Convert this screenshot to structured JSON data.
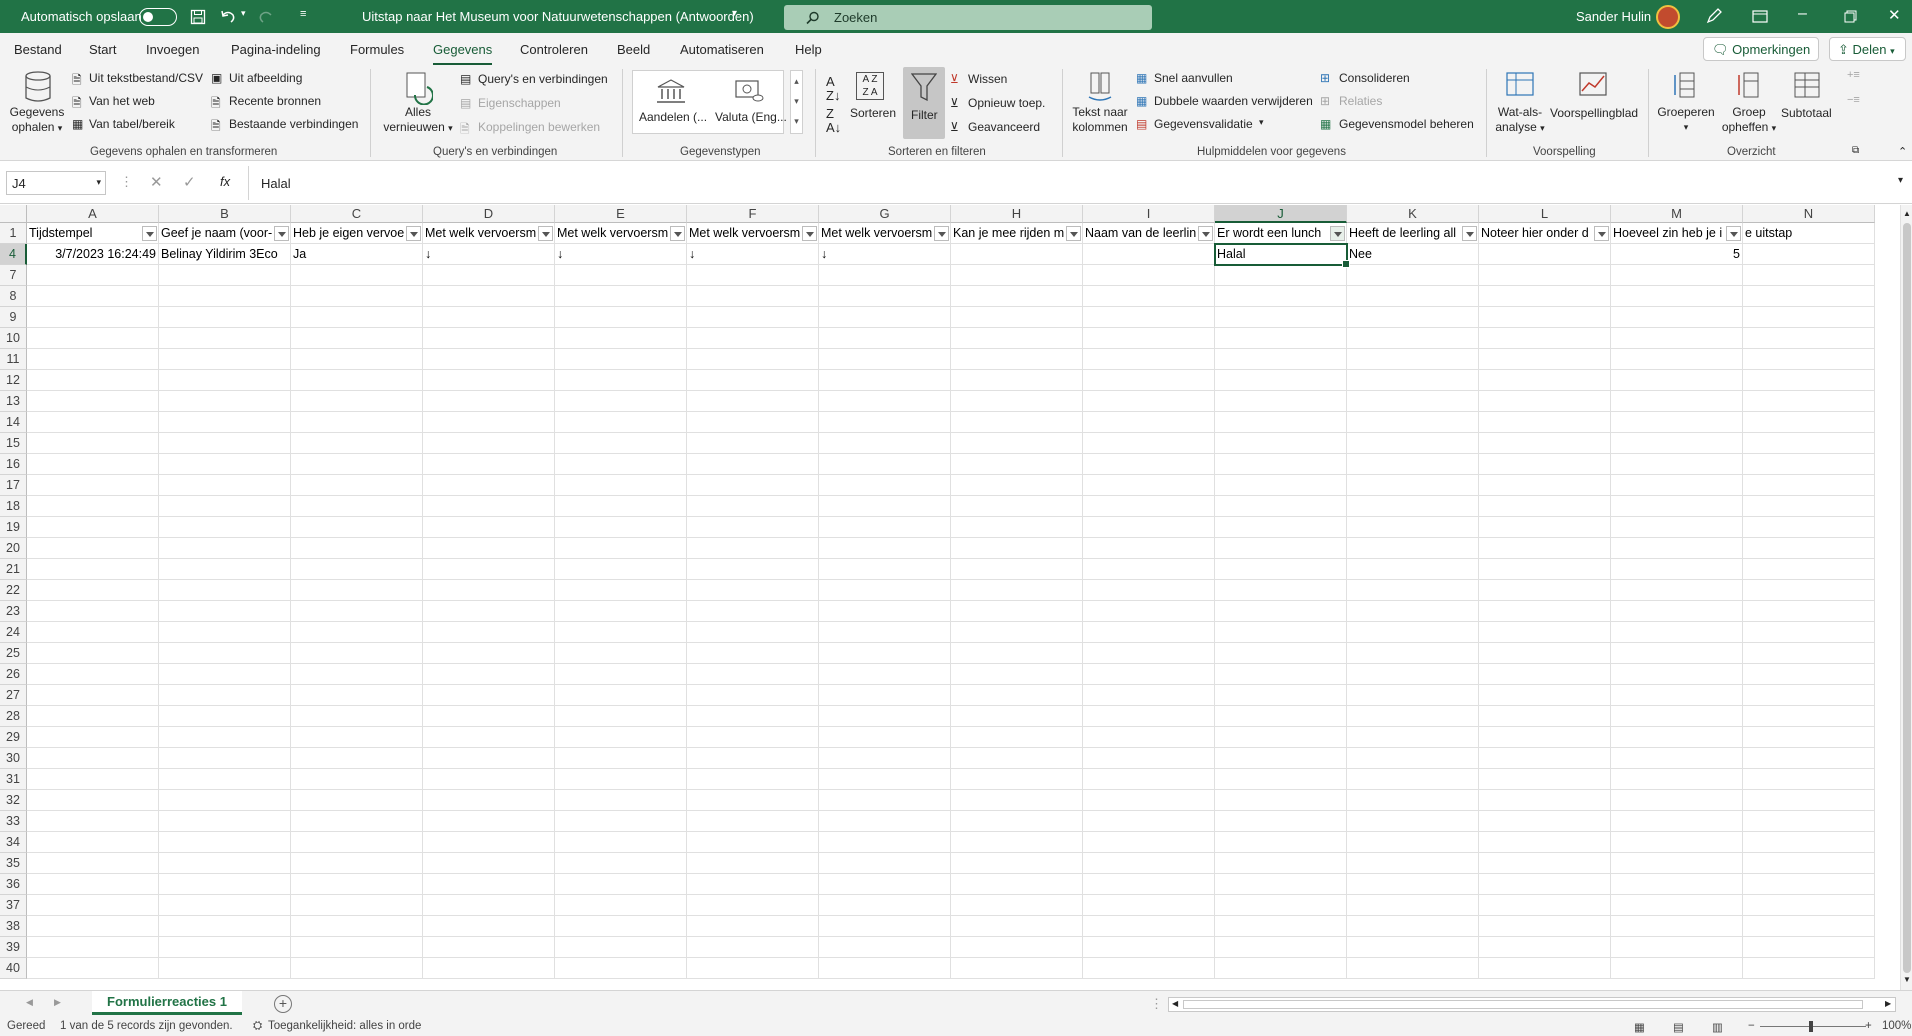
{
  "titlebar": {
    "autosave_label": "Automatisch opslaan",
    "doc_title": "Uitstap naar Het Museum voor Natuurwetenschappen (Antwoorden)",
    "search_placeholder": "Zoeken",
    "user_name": "Sander Hulin"
  },
  "menu": {
    "items": [
      "Bestand",
      "Start",
      "Invoegen",
      "Pagina-indeling",
      "Formules",
      "Gegevens",
      "Controleren",
      "Beeld",
      "Automatiseren",
      "Help"
    ],
    "active": "Gegevens",
    "comments_label": "Opmerkingen",
    "share_label": "Delen"
  },
  "ribbon": {
    "get_data": {
      "label1": "Gegevens",
      "label2": "ophalen",
      "from_text": "Uit tekstbestand/CSV",
      "from_web": "Van het web",
      "from_table": "Van tabel/bereik",
      "from_image": "Uit afbeelding",
      "recent": "Recente bronnen",
      "existing": "Bestaande verbindingen",
      "group": "Gegevens ophalen en transformeren"
    },
    "queries": {
      "refresh1": "Alles",
      "refresh2": "vernieuwen",
      "queries": "Query's en verbindingen",
      "properties": "Eigenschappen",
      "edit_links": "Koppelingen bewerken",
      "group": "Query's en verbindingen"
    },
    "types": {
      "stocks": "Aandelen (...",
      "currency": "Valuta (Eng...",
      "group": "Gegevenstypen"
    },
    "sort": {
      "sort": "Sorteren",
      "filter": "Filter",
      "clear": "Wissen",
      "reapply": "Opnieuw toep.",
      "advanced": "Geavanceerd",
      "group": "Sorteren en filteren"
    },
    "tools": {
      "text_cols1": "Tekst naar",
      "text_cols2": "kolommen",
      "flash": "Snel aanvullen",
      "dupes": "Dubbele waarden verwijderen",
      "validation": "Gegevensvalidatie",
      "consolidate": "Consolideren",
      "relations": "Relaties",
      "model": "Gegevensmodel beheren",
      "group": "Hulpmiddelen voor gegevens"
    },
    "forecast": {
      "whatif1": "Wat-als-",
      "whatif2": "analyse",
      "sheet": "Voorspellingblad",
      "group": "Voorspelling"
    },
    "outline": {
      "group_btn": "Groeperen",
      "ungroup1": "Groep",
      "ungroup2": "opheffen",
      "subtotal": "Subtotaal",
      "group": "Overzicht"
    }
  },
  "formula_bar": {
    "name_box": "J4",
    "value": "Halal"
  },
  "columns": [
    "A",
    "B",
    "C",
    "D",
    "E",
    "F",
    "G",
    "H",
    "I",
    "J",
    "K",
    "L",
    "M",
    "N"
  ],
  "selected_column": "J",
  "header_row": {
    "row_number": "1",
    "cells": [
      "Tijdstempel",
      "Geef je naam (voor-",
      "Heb je eigen vervoe",
      "Met welk vervoersm",
      "Met welk vervoersm",
      "Met welk vervoersm",
      "Met welk vervoersm",
      "Kan je mee rijden m",
      "Naam van de leerlin",
      "Er wordt een lunch",
      "Heeft de leerling all",
      "Noteer hier onder d",
      "Hoeveel zin heb je i",
      "e uitstap"
    ]
  },
  "data_row": {
    "row_number": "4",
    "cells": [
      "3/7/2023 16:24:49",
      "Belinay Yildirim 3Eco",
      "Ja",
      "↓",
      "↓",
      "↓",
      "↓",
      "",
      "",
      "Halal",
      "Nee",
      "",
      "5",
      ""
    ]
  },
  "empty_rows": [
    "7",
    "8",
    "9",
    "10",
    "11",
    "12",
    "13",
    "14",
    "15",
    "16",
    "17",
    "18",
    "19",
    "20",
    "21",
    "22",
    "23",
    "24",
    "25",
    "26",
    "27",
    "28",
    "29",
    "30",
    "31",
    "32",
    "33",
    "34",
    "35",
    "36",
    "37",
    "38",
    "39",
    "40"
  ],
  "sheet_tab": "Formulierreacties 1",
  "status": {
    "ready": "Gereed",
    "records": "1 van de 5 records zijn gevonden.",
    "accessibility": "Toegankelijkheid: alles in orde",
    "zoom": "100%"
  }
}
